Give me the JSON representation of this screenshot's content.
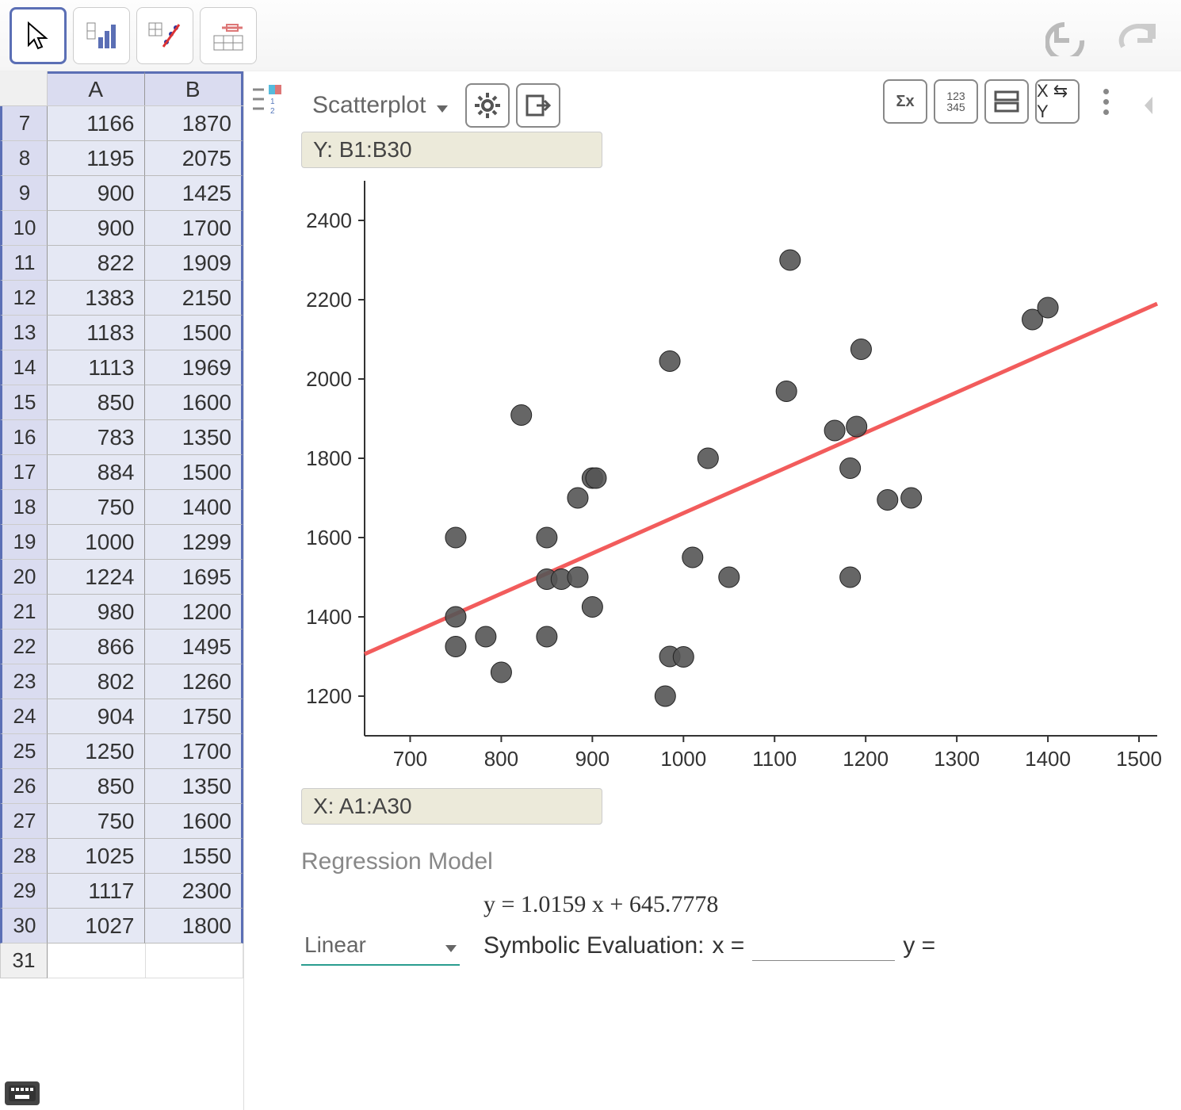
{
  "toolbar": {
    "pointer_tool_selected": true
  },
  "spreadsheet": {
    "columns": [
      "A",
      "B"
    ],
    "start_row": 7,
    "rows": [
      {
        "n": 7,
        "a": 1166,
        "b": 1870
      },
      {
        "n": 8,
        "a": 1195,
        "b": 2075
      },
      {
        "n": 9,
        "a": 900,
        "b": 1425
      },
      {
        "n": 10,
        "a": 900,
        "b": 1700
      },
      {
        "n": 11,
        "a": 822,
        "b": 1909
      },
      {
        "n": 12,
        "a": 1383,
        "b": 2150
      },
      {
        "n": 13,
        "a": 1183,
        "b": 1500
      },
      {
        "n": 14,
        "a": 1113,
        "b": 1969
      },
      {
        "n": 15,
        "a": 850,
        "b": 1600
      },
      {
        "n": 16,
        "a": 783,
        "b": 1350
      },
      {
        "n": 17,
        "a": 884,
        "b": 1500
      },
      {
        "n": 18,
        "a": 750,
        "b": 1400
      },
      {
        "n": 19,
        "a": 1000,
        "b": 1299
      },
      {
        "n": 20,
        "a": 1224,
        "b": 1695
      },
      {
        "n": 21,
        "a": 980,
        "b": 1200
      },
      {
        "n": 22,
        "a": 866,
        "b": 1495
      },
      {
        "n": 23,
        "a": 802,
        "b": 1260
      },
      {
        "n": 24,
        "a": 904,
        "b": 1750
      },
      {
        "n": 25,
        "a": 1250,
        "b": 1700
      },
      {
        "n": 26,
        "a": 850,
        "b": 1350
      },
      {
        "n": 27,
        "a": 750,
        "b": 1600
      },
      {
        "n": 28,
        "a": 1025,
        "b": 1550
      },
      {
        "n": 29,
        "a": 1117,
        "b": 2300
      },
      {
        "n": 30,
        "a": 1027,
        "b": 1800
      }
    ],
    "empty_rows": [
      31
    ]
  },
  "analysis": {
    "chart_type_label": "Scatterplot",
    "y_range_label": "Y: B1:B30",
    "x_range_label": "X: A1:A30",
    "xy_swap_label": "X ⇆ Y",
    "regression_title": "Regression Model",
    "regression_type": "Linear",
    "equation": "y = 1.0159 x + 645.7778",
    "symbolic_label": "Symbolic Evaluation:",
    "x_label": "x =",
    "y_label": "y ="
  },
  "chart_data": {
    "type": "scatter",
    "title": "",
    "xlabel": "",
    "ylabel": "",
    "xlim": [
      650,
      1520
    ],
    "ylim": [
      1100,
      2500
    ],
    "xticks": [
      700,
      800,
      900,
      1000,
      1100,
      1200,
      1300,
      1400,
      1500
    ],
    "yticks": [
      1200,
      1400,
      1600,
      1800,
      2000,
      2200,
      2400
    ],
    "regression": {
      "slope": 1.0159,
      "intercept": 645.7778,
      "color": "#f25c5c"
    },
    "point_color": "#555",
    "points": [
      {
        "x": 750,
        "y": 1325
      },
      {
        "x": 750,
        "y": 1400
      },
      {
        "x": 750,
        "y": 1600
      },
      {
        "x": 783,
        "y": 1350
      },
      {
        "x": 800,
        "y": 1260
      },
      {
        "x": 822,
        "y": 1909
      },
      {
        "x": 850,
        "y": 1350
      },
      {
        "x": 850,
        "y": 1495
      },
      {
        "x": 850,
        "y": 1600
      },
      {
        "x": 866,
        "y": 1495
      },
      {
        "x": 884,
        "y": 1500
      },
      {
        "x": 884,
        "y": 1700
      },
      {
        "x": 900,
        "y": 1425
      },
      {
        "x": 900,
        "y": 1750
      },
      {
        "x": 904,
        "y": 1750
      },
      {
        "x": 980,
        "y": 1200
      },
      {
        "x": 985,
        "y": 1300
      },
      {
        "x": 985,
        "y": 2045
      },
      {
        "x": 1000,
        "y": 1299
      },
      {
        "x": 1010,
        "y": 1550
      },
      {
        "x": 1027,
        "y": 1800
      },
      {
        "x": 1050,
        "y": 1500
      },
      {
        "x": 1113,
        "y": 1969
      },
      {
        "x": 1117,
        "y": 2300
      },
      {
        "x": 1166,
        "y": 1870
      },
      {
        "x": 1183,
        "y": 1500
      },
      {
        "x": 1183,
        "y": 1775
      },
      {
        "x": 1190,
        "y": 1880
      },
      {
        "x": 1195,
        "y": 2075
      },
      {
        "x": 1224,
        "y": 1695
      },
      {
        "x": 1250,
        "y": 1700
      },
      {
        "x": 1383,
        "b": 2150,
        "y": 2150
      },
      {
        "x": 1400,
        "y": 2180
      }
    ]
  }
}
